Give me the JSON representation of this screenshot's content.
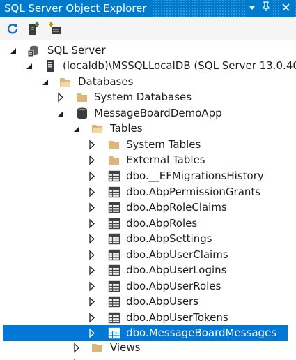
{
  "window": {
    "title": "SQL Server Object Explorer",
    "buttons": [
      "▼",
      "⊥",
      "✕"
    ]
  },
  "toolbar": {
    "tools": [
      "refresh-icon",
      "add-sql-server-icon",
      "new-query-icon"
    ]
  },
  "tree": {
    "sql_server": "SQL Server",
    "instance": "(localdb)\\MSSQLLocalDB (SQL Server 13.0.40",
    "databases": "Databases",
    "system_databases": "System Databases",
    "database": "MessageBoardDemoApp",
    "tables": "Tables",
    "system_tables": "System Tables",
    "external_tables": "External Tables",
    "table_items": [
      "dbo.__EFMigrationsHistory",
      "dbo.AbpPermissionGrants",
      "dbo.AbpRoleClaims",
      "dbo.AbpRoles",
      "dbo.AbpSettings",
      "dbo.AbpUserClaims",
      "dbo.AbpUserLogins",
      "dbo.AbpUserRoles",
      "dbo.AbpUsers",
      "dbo.AbpUserTokens",
      "dbo.MessageBoardMessages"
    ],
    "views": "Views"
  },
  "colors": {
    "title_bar": "#007acc",
    "selection": "#0078d7",
    "folder": "#dcb67a",
    "table_icon": "#424242"
  }
}
